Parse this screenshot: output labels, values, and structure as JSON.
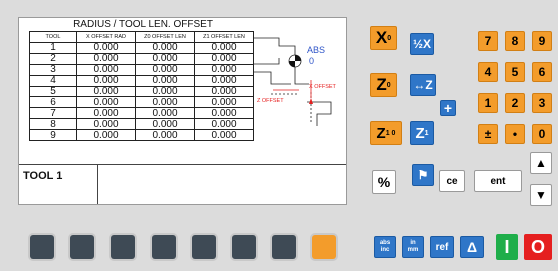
{
  "screen": {
    "title": "RADIUS / TOOL LEN. OFFSET",
    "columns": [
      "TOOL",
      "X OFFSET RAD",
      "Z0 OFFSET LEN",
      "Z1 OFFSET LEN"
    ],
    "rows": [
      {
        "tool": "1",
        "x": "0.000",
        "z0": "0.000",
        "z1": "0.000"
      },
      {
        "tool": "2",
        "x": "0.000",
        "z0": "0.000",
        "z1": "0.000"
      },
      {
        "tool": "3",
        "x": "0.000",
        "z0": "0.000",
        "z1": "0.000"
      },
      {
        "tool": "4",
        "x": "0.000",
        "z0": "0.000",
        "z1": "0.000"
      },
      {
        "tool": "5",
        "x": "0.000",
        "z0": "0.000",
        "z1": "0.000"
      },
      {
        "tool": "6",
        "x": "0.000",
        "z0": "0.000",
        "z1": "0.000"
      },
      {
        "tool": "7",
        "x": "0.000",
        "z0": "0.000",
        "z1": "0.000"
      },
      {
        "tool": "8",
        "x": "0.000",
        "z0": "0.000",
        "z1": "0.000"
      },
      {
        "tool": "9",
        "x": "0.000",
        "z0": "0.000",
        "z1": "0.000"
      }
    ],
    "diagram": {
      "abs": "ABS",
      "zero": "0",
      "x_offset": "X OFFSET",
      "z_offset": "Z OFFSET"
    },
    "tool_status": "TOOL 1"
  },
  "keys": {
    "x0": "X",
    "x0_sub": "0",
    "z0": "Z",
    "z0_sub": "0",
    "z10": "Z",
    "z10_sub": "1 0",
    "half_x": "½X",
    "z_arrow": "↔Z",
    "z1": "Z",
    "z1_sub": "1",
    "plus": "+",
    "fraction": "%",
    "tool_key": "⚑",
    "ce": "ce",
    "ent": "ent",
    "num": [
      "7",
      "8",
      "9",
      "4",
      "5",
      "6",
      "1",
      "2",
      "3",
      "±",
      "•",
      "0"
    ],
    "abs_inc": [
      "abs",
      "inc"
    ],
    "in_mm": [
      "in",
      "mm"
    ],
    "ref": "ref",
    "delta": "Δ",
    "on": "I",
    "off": "O"
  },
  "colors": {
    "orange": "#f39c2b",
    "blue": "#2f76c8",
    "green": "#1fae4a",
    "red": "#e51f1f",
    "softkey": "#3e4a55"
  }
}
